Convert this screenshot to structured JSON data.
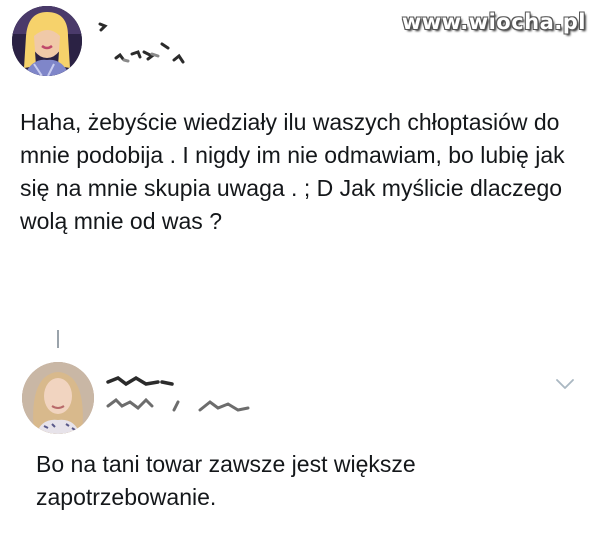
{
  "watermark": "www.wiocha.pl",
  "colors": {
    "text": "#14171a",
    "thread_line": "#9aa3ab",
    "chevron": "#aab8c2",
    "scribble": "#2b2b2b"
  },
  "tweet": {
    "author_avatar": "profile-photo-icon",
    "text": "Haha, żebyście wiedziały ilu waszych chłoptasiów do mnie podobija . I nigdy im nie odmawiam, bo lubię jak się na mnie skupia uwaga . ; D Jak myślicie dlaczego wolą mnie od was ?"
  },
  "reply": {
    "author_avatar": "profile-photo-icon",
    "menu_icon": "chevron-down-icon",
    "text": "Bo na tani towar zawsze jest większe zapotrzebowanie."
  }
}
